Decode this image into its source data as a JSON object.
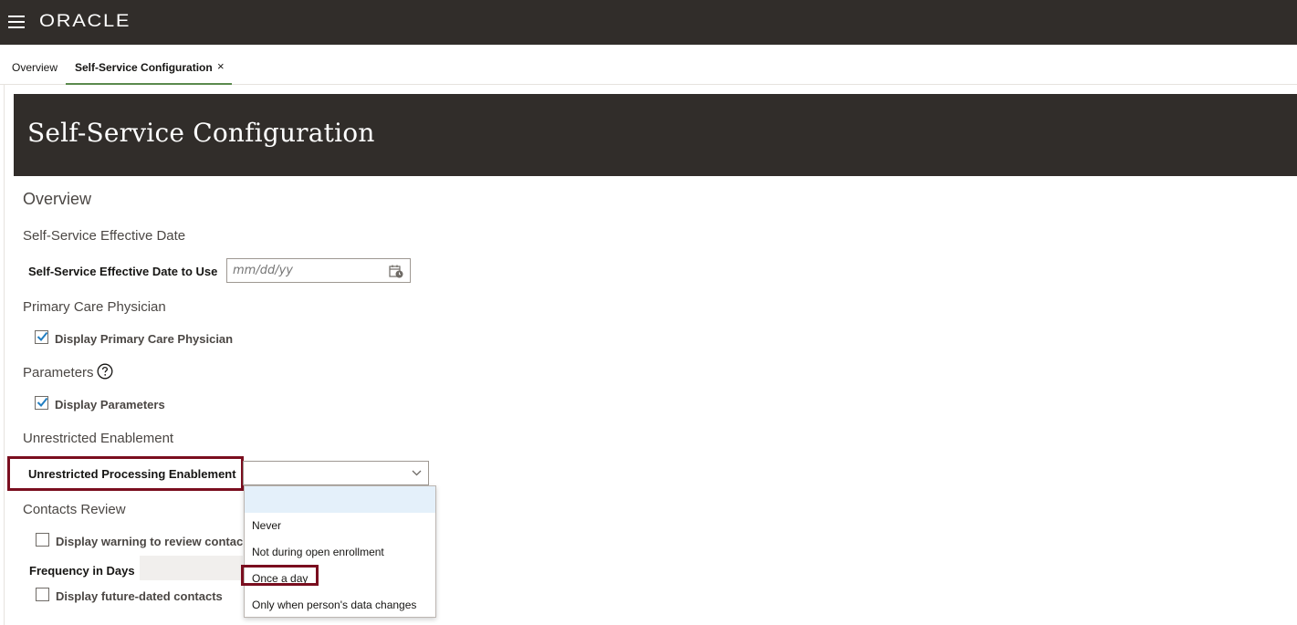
{
  "app": {
    "logo": "ORACLE"
  },
  "tabs": [
    {
      "label": "Overview"
    },
    {
      "label": "Self-Service Configuration",
      "close": "×"
    }
  ],
  "page": {
    "title": "Self-Service Configuration",
    "overview_heading": "Overview"
  },
  "effective_date": {
    "heading": "Self-Service Effective Date",
    "label": "Self-Service Effective Date to Use",
    "placeholder": "mm/dd/yy",
    "value": ""
  },
  "pcp": {
    "heading": "Primary Care Physician",
    "checkbox_label": "Display Primary Care Physician",
    "checked": true
  },
  "parameters": {
    "heading": "Parameters",
    "checkbox_label": "Display Parameters",
    "checked": true
  },
  "unrestricted": {
    "heading": "Unrestricted Enablement",
    "label": "Unrestricted Processing Enablement",
    "selected": "",
    "options": [
      "",
      "Never",
      "Not during open enrollment",
      "Once a day",
      "Only when person's data changes"
    ]
  },
  "contacts": {
    "heading": "Contacts Review",
    "warning_label": "Display warning to review contac",
    "warning_checked": false,
    "frequency_label": "Frequency in Days",
    "future_label": "Display future-dated contacts",
    "future_checked": false
  },
  "colors": {
    "header_bg": "#312d2a",
    "highlight": "#7a0e1f",
    "active_tab_underline": "#5b8a4e",
    "checkmark": "#227ec1",
    "dropdown_hover": "#e4f0fa"
  },
  "icons": [
    "menu-icon",
    "close-icon",
    "calendar-icon",
    "check-icon",
    "help-icon",
    "chevron-down-icon"
  ]
}
